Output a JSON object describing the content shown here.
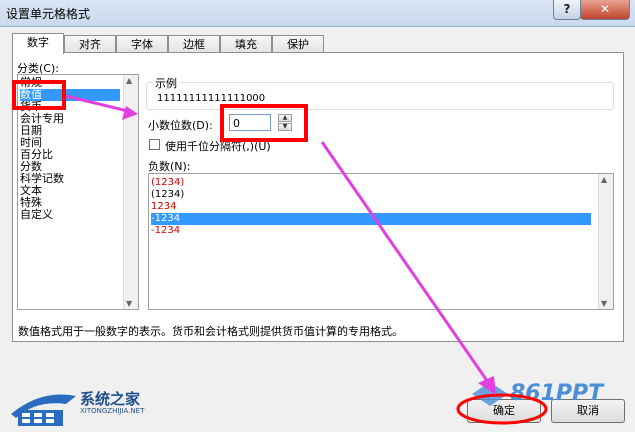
{
  "window": {
    "title": "设置单元格格式",
    "help_glyph": "?",
    "close_glyph": "✕"
  },
  "tabs": [
    {
      "label": "数字"
    },
    {
      "label": "对齐"
    },
    {
      "label": "字体"
    },
    {
      "label": "边框"
    },
    {
      "label": "填充"
    },
    {
      "label": "保护"
    }
  ],
  "category": {
    "label": "分类(C):",
    "items": [
      "常规",
      "数值",
      "货币",
      "会计专用",
      "日期",
      "时间",
      "百分比",
      "分数",
      "科学记数",
      "文本",
      "特殊",
      "自定义"
    ],
    "selected": "数值"
  },
  "sample": {
    "label": "示例",
    "value": "11111111111111000"
  },
  "decimal": {
    "label": "小数位数(D):",
    "value": "0"
  },
  "thousands": {
    "label": "使用千位分隔符(,)(U)",
    "checked": false
  },
  "negative": {
    "label": "负数(N):",
    "items": [
      "(1234)",
      "(1234)",
      "1234",
      "-1234",
      "-1234"
    ],
    "selected_index": 3
  },
  "description": "数值格式用于一般数字的表示。货币和会计格式则提供货币值计算的专用格式。",
  "buttons": {
    "ok": "确定",
    "cancel": "取消"
  },
  "watermark": {
    "left_name": "系统之家",
    "left_url": "XITONGZHIJIA.NET",
    "right_name": "861PPT"
  },
  "colors": {
    "highlight": "#3399ff",
    "annotation_red": "#ff0000",
    "annotation_arrow": "#e040e0",
    "negative_red": "#d00000"
  }
}
